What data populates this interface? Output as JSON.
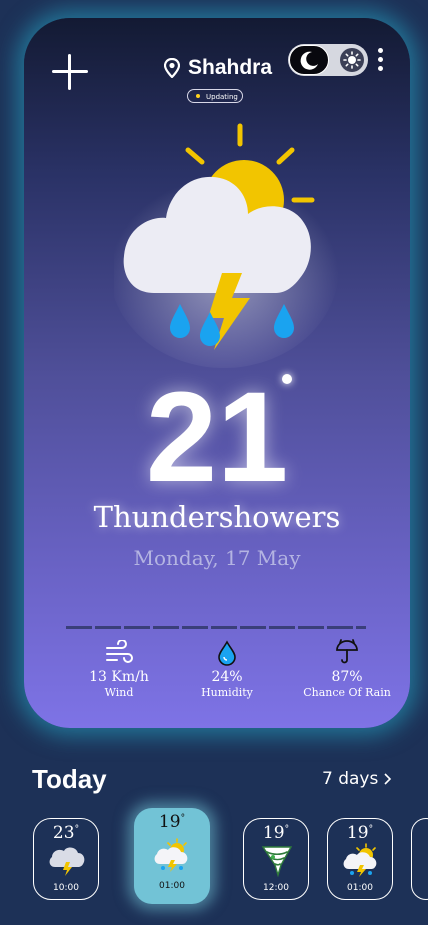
{
  "header": {
    "add_icon": "plus-icon",
    "location_icon": "map-pin-icon",
    "location": "Shahdra",
    "status": "Updating",
    "theme_toggle": {
      "dark_icon": "moon-icon",
      "light_icon": "sun-icon",
      "selected": "dark"
    },
    "menu_icon": "kebab-menu-icon"
  },
  "current": {
    "icon": "thunderstorm-icon",
    "temperature": "21",
    "condition": "Thundershowers",
    "date": "Monday, 17 May"
  },
  "stats": [
    {
      "icon": "wind-icon",
      "value": "13 Km/h",
      "label": "Wind"
    },
    {
      "icon": "humidity-drop-icon",
      "value": "24%",
      "label": "Humidity"
    },
    {
      "icon": "rain-umbrella-icon",
      "value": "87%",
      "label": "Chance Of Rain"
    }
  ],
  "forecast": {
    "title": "Today",
    "link": "7 days",
    "hours": [
      {
        "temp": "23",
        "time": "10:00",
        "icon": "cloud-lightning-icon"
      },
      {
        "temp": "19",
        "time": "01:00",
        "icon": "sun-cloud-storm-icon",
        "active": true
      },
      {
        "temp": "19",
        "time": "12:00",
        "icon": "tornado-icon"
      },
      {
        "temp": "19",
        "time": "01:00",
        "icon": "sun-cloud-storm-icon"
      }
    ]
  },
  "colors": {
    "accent": "#72c3d6",
    "background": "#1d3157",
    "sun": "#f2c500",
    "rain": "#1aa3f0"
  }
}
